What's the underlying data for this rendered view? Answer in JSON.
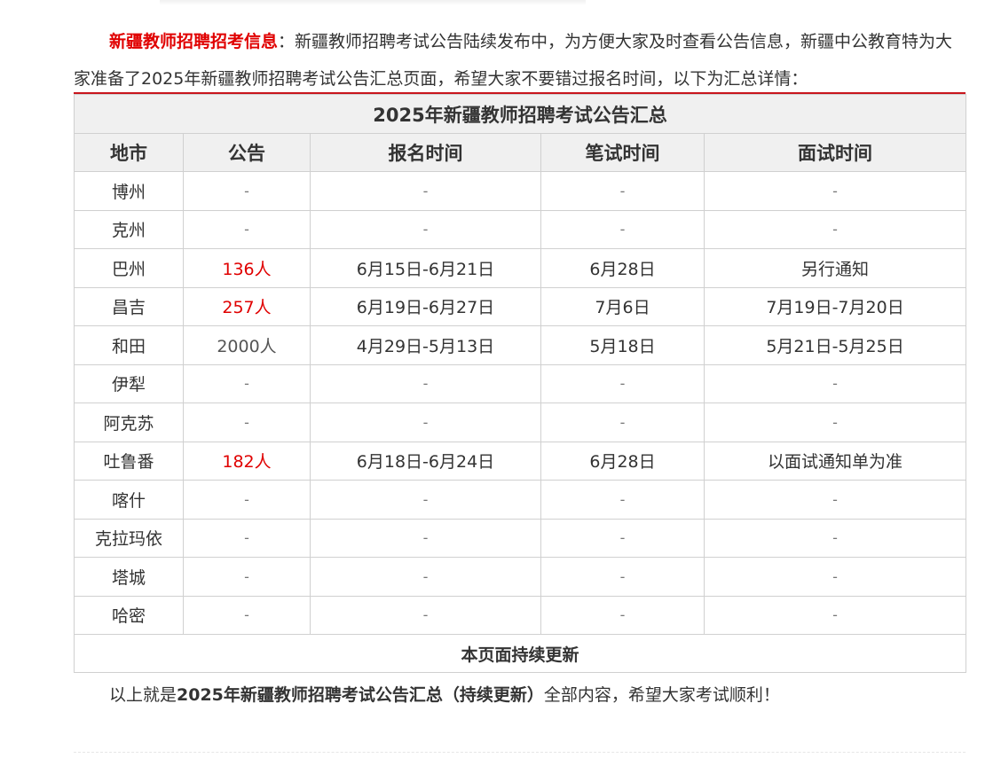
{
  "intro": {
    "lead": "新疆教师招聘招考信息",
    "sep": "：",
    "text": "新疆教师招聘考试公告陆续发布中，为方便大家及时查看公告信息，新疆中公教育特为大家准备了2025年新疆教师招聘考试公告汇总页面，希望大家不要错过报名时间，以下为汇总详情："
  },
  "table": {
    "title": "2025年新疆教师招聘考试公告汇总",
    "headers": [
      "地市",
      "公告",
      "报名时间",
      "笔试时间",
      "面试时间"
    ],
    "rows": [
      {
        "city": "博州",
        "notice": "-",
        "signup": "-",
        "written": "-",
        "interview": "-"
      },
      {
        "city": "克州",
        "notice": "-",
        "signup": "-",
        "written": "-",
        "interview": "-"
      },
      {
        "city": "巴州",
        "notice": "136人",
        "signup": "6月15日-6月21日",
        "written": "6月28日",
        "interview": "另行通知"
      },
      {
        "city": "昌吉",
        "notice": "257人",
        "signup": "6月19日-6月27日",
        "written": "7月6日",
        "interview": "7月19日-7月20日"
      },
      {
        "city": "和田",
        "notice": "2000人",
        "signup": "4月29日-5月13日",
        "written": "5月18日",
        "interview": "5月21日-5月25日"
      },
      {
        "city": "伊犁",
        "notice": "-",
        "signup": "-",
        "written": "-",
        "interview": "-"
      },
      {
        "city": "阿克苏",
        "notice": "-",
        "signup": "-",
        "written": "-",
        "interview": "-"
      },
      {
        "city": "吐鲁番",
        "notice": "182人",
        "signup": "6月18日-6月24日",
        "written": "6月28日",
        "interview": "以面试通知单为准"
      },
      {
        "city": "喀什",
        "notice": "-",
        "signup": "-",
        "written": "-",
        "interview": "-"
      },
      {
        "city": "克拉玛依",
        "notice": "-",
        "signup": "-",
        "written": "-",
        "interview": "-"
      },
      {
        "city": "塔城",
        "notice": "-",
        "signup": "-",
        "written": "-",
        "interview": "-"
      },
      {
        "city": "哈密",
        "notice": "-",
        "signup": "-",
        "written": "-",
        "interview": "-"
      }
    ],
    "footer": "本页面持续更新"
  },
  "outro": {
    "pre": "以上就是",
    "bold": "2025年新疆教师招聘考试公告汇总（持续更新）",
    "post": "全部内容，希望大家考试顺利！"
  },
  "colors": {
    "accent_red": "#e00000",
    "table_top_border": "#c8161d",
    "header_bg": "#f0f0f0"
  }
}
